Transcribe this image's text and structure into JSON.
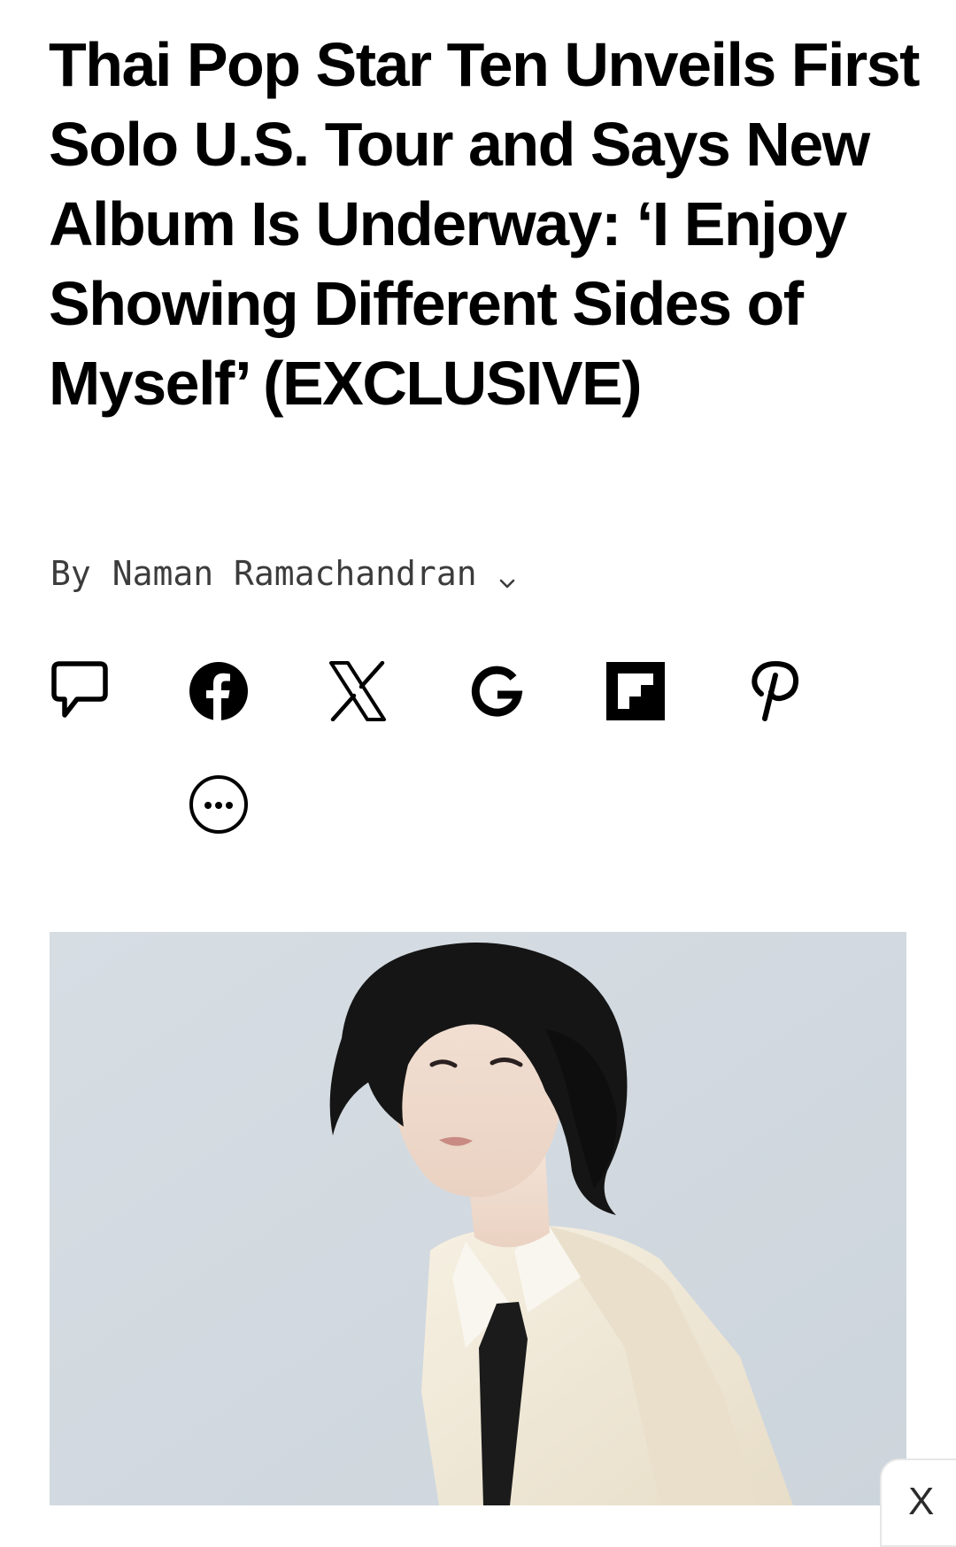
{
  "article": {
    "headline": "Thai Pop Star Ten Unveils First Solo U.S. Tour and Says New Album Is Underway: ‘I Enjoy Showing Different Sides of Myself’ (EXCLUSIVE)",
    "byline_prefix": "By",
    "author": "Naman Ramachandran"
  },
  "share": {
    "buttons": [
      {
        "icon": "comment-icon"
      },
      {
        "icon": "facebook-icon"
      },
      {
        "icon": "x-icon"
      },
      {
        "icon": "google-icon"
      },
      {
        "icon": "flipboard-icon"
      },
      {
        "icon": "pinterest-icon"
      },
      {
        "icon": "more-icon"
      }
    ]
  },
  "hero_image": {
    "subject": "portrait photo"
  },
  "overlay": {
    "close_label": "X"
  },
  "colors": {
    "text": "#000000",
    "byline": "#3c3c3c",
    "image_background": "#d3dbe1"
  }
}
